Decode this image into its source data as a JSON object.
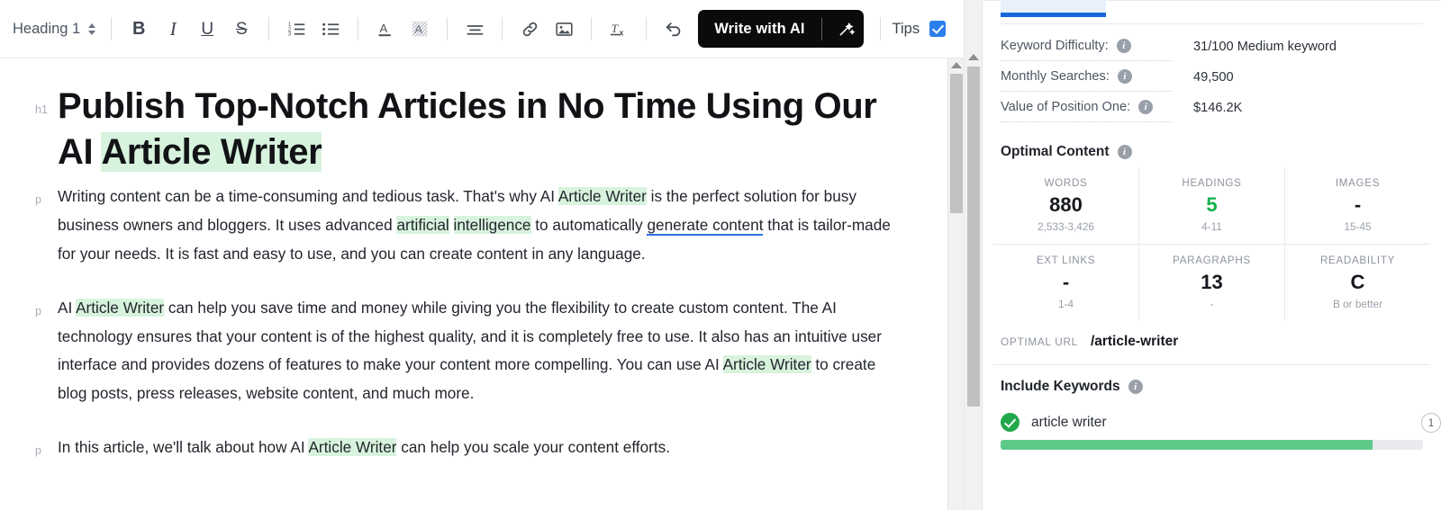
{
  "toolbar": {
    "style_select": {
      "value": "Heading 1",
      "icon": "updown-chevrons-icon"
    },
    "buttons": [
      {
        "name": "bold",
        "glyph": "B"
      },
      {
        "name": "italic",
        "glyph": "I"
      },
      {
        "name": "underline",
        "glyph": "U"
      },
      {
        "name": "strikethrough",
        "glyph": "S"
      }
    ],
    "ai_button": {
      "label": "Write with AI",
      "icon": "magic-wand-icon"
    },
    "tips": {
      "label": "Tips",
      "checked": true,
      "color": "#2b7fec"
    }
  },
  "document": {
    "blocks": [
      {
        "gutter": "h1",
        "type": "h1",
        "runs": [
          {
            "text": "Publish Top-Notch Articles in No Time Using Our AI ",
            "style": "plain"
          },
          {
            "text": "Article Writer",
            "style": "highlight"
          }
        ]
      },
      {
        "gutter": "p",
        "type": "p",
        "runs": [
          {
            "text": "Writing content can be a time-consuming and tedious task. That's why AI ",
            "style": "plain"
          },
          {
            "text": "Article Writer",
            "style": "highlight"
          },
          {
            "text": " is the perfect solution for busy business owners and bloggers. It uses advanced ",
            "style": "plain"
          },
          {
            "text": "artificial",
            "style": "highlight"
          },
          {
            "text": " ",
            "style": "plain"
          },
          {
            "text": "intelligence",
            "style": "highlight"
          },
          {
            "text": " to automatically ",
            "style": "plain"
          },
          {
            "text": "generate content",
            "style": "link"
          },
          {
            "text": " that is tailor-made for your needs. It is fast and easy to use, and you can create content in any language.",
            "style": "plain"
          }
        ]
      },
      {
        "gutter": "p",
        "type": "p",
        "runs": [
          {
            "text": "AI ",
            "style": "plain"
          },
          {
            "text": "Article Writer",
            "style": "highlight"
          },
          {
            "text": " can help you save time and money while giving you the flexibility to create custom content. The AI technology ensures that your content is of the highest quality, and it is completely free to use. It also has an intuitive user interface and provides dozens of features to make your content more compelling. You can use AI ",
            "style": "plain"
          },
          {
            "text": "Article Writer",
            "style": "highlight"
          },
          {
            "text": " to create blog posts, press releases, website content, and much more.",
            "style": "plain"
          }
        ]
      },
      {
        "gutter": "p",
        "type": "p",
        "runs": [
          {
            "text": "In this article, we'll talk about how AI ",
            "style": "plain"
          },
          {
            "text": "Article Writer",
            "style": "highlight"
          },
          {
            "text": " can help you scale your content efforts.",
            "style": "plain"
          }
        ]
      }
    ],
    "highlight_color": "#d8f3dd",
    "link_underline_color": "#2f6fe0"
  },
  "right_panel": {
    "active_tab_color": "#1668dc",
    "metrics": [
      {
        "label": "Keyword Difficulty:",
        "value": "31/100 Medium keyword"
      },
      {
        "label": "Monthly Searches:",
        "value": "49,500"
      },
      {
        "label": "Value of Position One:",
        "value": "$146.2K"
      }
    ],
    "optimal_content": {
      "title": "Optimal Content",
      "cells": [
        {
          "key": "WORDS",
          "value": "880",
          "range": "2,533-3,426",
          "value_color": "#15181d"
        },
        {
          "key": "HEADINGS",
          "value": "5",
          "range": "4-11",
          "value_color": "#14b14b"
        },
        {
          "key": "IMAGES",
          "value": "-",
          "range": "15-45",
          "value_color": "#15181d"
        },
        {
          "key": "EXT LINKS",
          "value": "-",
          "range": "1-4",
          "value_color": "#15181d"
        },
        {
          "key": "PARAGRAPHS",
          "value": "13",
          "range": "-",
          "value_color": "#15181d"
        },
        {
          "key": "READABILITY",
          "value": "C",
          "range": "B or better",
          "value_color": "#15181d"
        }
      ]
    },
    "optimal_url": {
      "key": "OPTIMAL URL",
      "value": "/article-writer"
    },
    "include_keywords": {
      "title": "Include Keywords",
      "items": [
        {
          "name": "article writer",
          "status": "check",
          "badge": "1",
          "progress": 88
        }
      ]
    }
  }
}
